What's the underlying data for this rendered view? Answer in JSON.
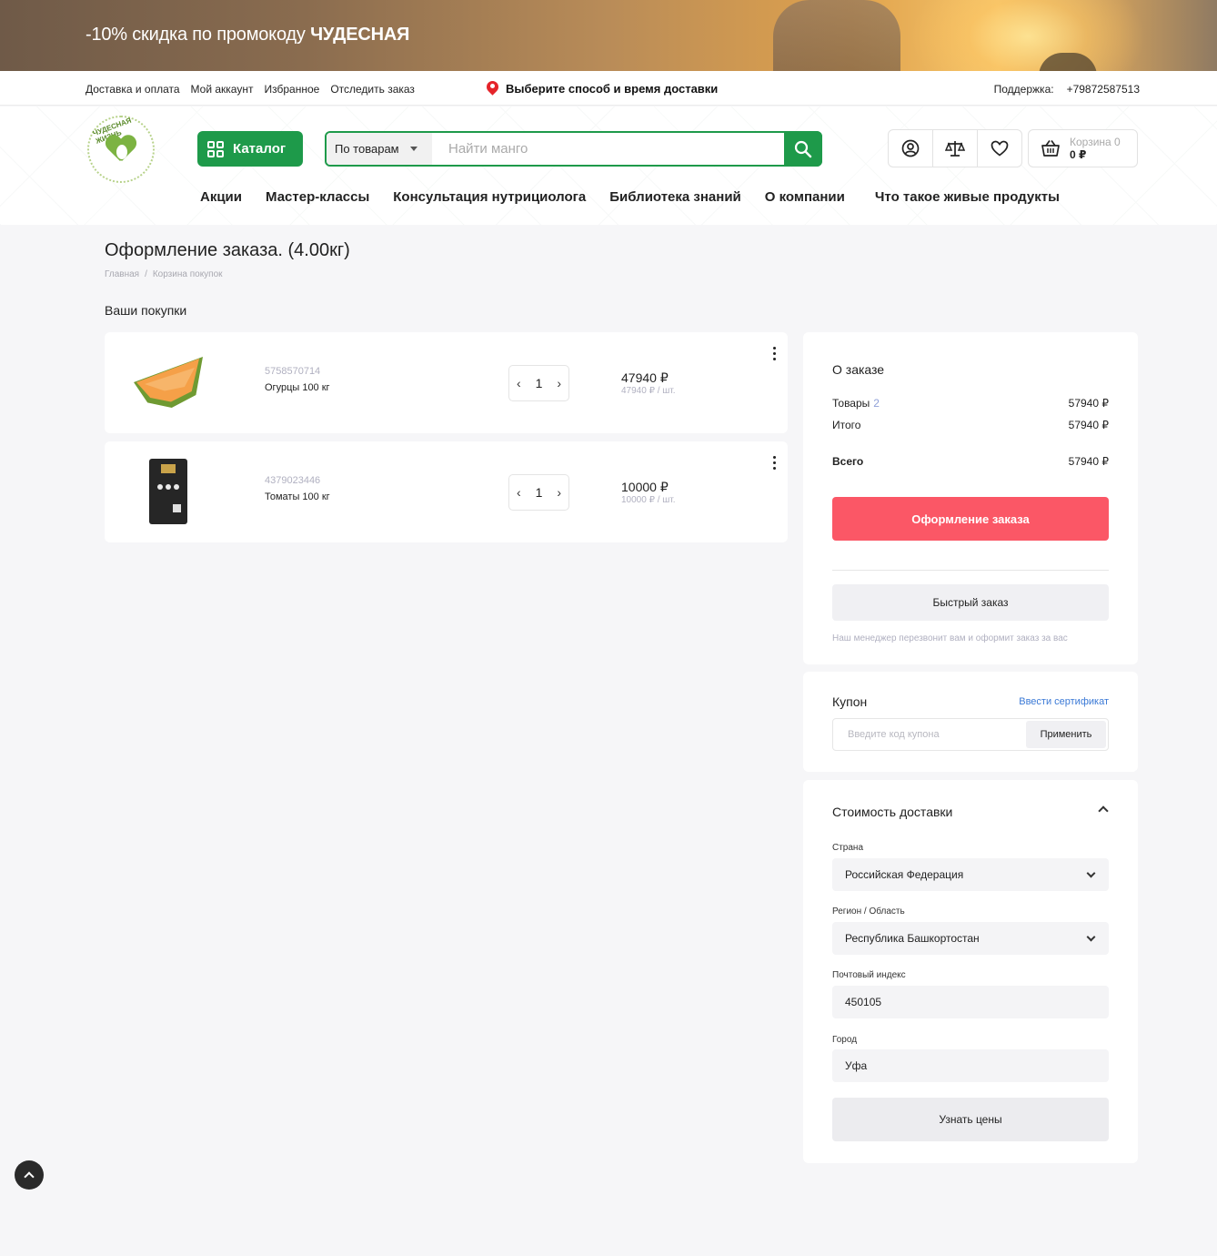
{
  "promo": {
    "text": "-10% скидка по промокоду ",
    "code": "ЧУДЕСНАЯ"
  },
  "topbar": {
    "links": [
      "Доставка и оплата",
      "Мой аккаунт",
      "Избранное",
      "Отследить заказ"
    ],
    "delivery": "Выберите способ и время доставки",
    "support_label": "Поддержка:",
    "phone": "+79872587513"
  },
  "header": {
    "logo_text": "ЧУДЕСНАЯ ЖИЗНЬ",
    "catalog_label": "Каталог",
    "search_scope": "По товарам",
    "search_placeholder": "Найти манго",
    "cart_label": "Корзина 0",
    "cart_total": "0 ₽",
    "nav": [
      "Акции",
      "Мастер-классы",
      "Консультация нутрициолога",
      "Библиотека знаний",
      "О компании",
      "Что такое живые продукты"
    ]
  },
  "page": {
    "title": "Оформление заказа. (4.00кг)",
    "breadcrumb": [
      "Главная",
      "/",
      "Корзина покупок"
    ],
    "section": "Ваши покупки"
  },
  "items": [
    {
      "sku": "5758570714",
      "name": "Огурцы 100 кг",
      "qty": "1",
      "price": "47940 ₽",
      "unit": "47940 ₽ / шт."
    },
    {
      "sku": "4379023446",
      "name": "Томаты 100 кг",
      "qty": "1",
      "price": "10000 ₽",
      "unit": "10000 ₽ / шт."
    }
  ],
  "summary": {
    "title": "О заказе",
    "goods_label": "Товары",
    "goods_count": "2",
    "goods_sum": "57940 ₽",
    "subtotal_label": "Итого",
    "subtotal_sum": "57940 ₽",
    "total_label": "Всего",
    "total_sum": "57940 ₽",
    "checkout_label": "Оформление заказа",
    "quick_label": "Быстрый заказ",
    "quick_note": "Наш менеджер перезвонит вам и оформит заказ за вас"
  },
  "coupon": {
    "title": "Купон",
    "certificate_link": "Ввести сертификат",
    "placeholder": "Введите код купона",
    "apply_label": "Применить"
  },
  "shipping": {
    "title": "Стоимость доставки",
    "country_label": "Страна",
    "country_value": "Российская Федерация",
    "region_label": "Регион / Область",
    "region_value": "Республика Башкортостан",
    "zip_label": "Почтовый индекс",
    "zip_value": "450105",
    "city_label": "Город",
    "city_value": "Уфа",
    "prices_label": "Узнать цены"
  },
  "colors": {
    "brand_green": "#1e9a4a",
    "checkout_red": "#fb5766",
    "link_blue": "#3a79d6"
  }
}
